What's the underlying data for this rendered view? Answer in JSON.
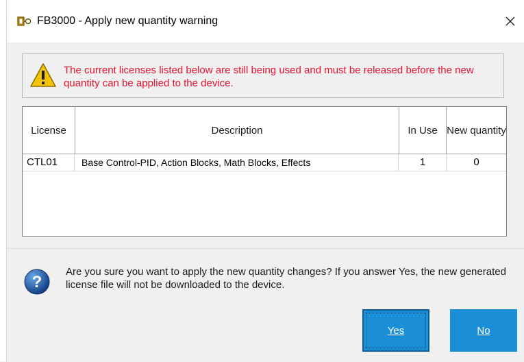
{
  "window": {
    "title": "FB3000 - Apply new quantity warning",
    "close_glyph": "✕"
  },
  "warning": {
    "icon": "warning-triangle-icon",
    "text": "The current licenses listed below are still being used and must be released before the new quantity can be applied to the device.",
    "color": "#e8102b"
  },
  "table": {
    "columns": [
      "License",
      "Description",
      "In Use",
      "New quantity"
    ],
    "rows": [
      {
        "license": "CTL01",
        "description": "Base Control-PID, Action Blocks, Math Blocks, Effects",
        "in_use": "1",
        "new_quantity": "0"
      }
    ]
  },
  "question": {
    "icon": "question-icon",
    "text": "Are you sure you want to apply the new quantity changes? If you answer Yes, the new generated license file will not be downloaded to the device."
  },
  "buttons": {
    "yes_label": "Yes",
    "no_label": "No",
    "color": "#1a8ed6"
  }
}
